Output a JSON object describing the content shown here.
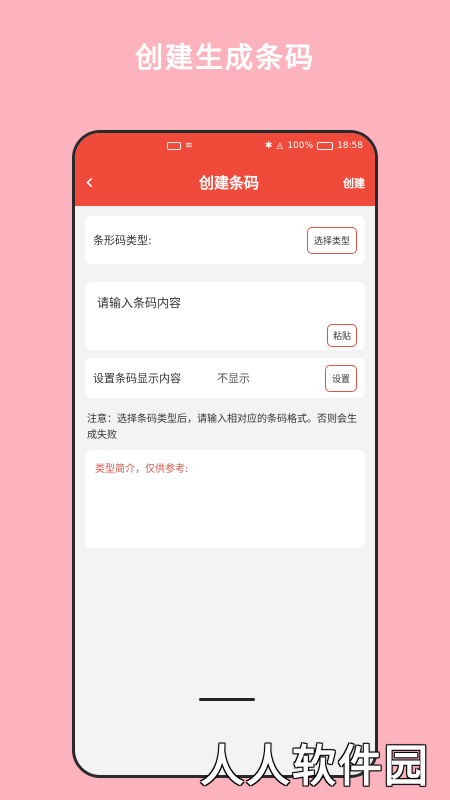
{
  "promo": {
    "title": "创建生成条码"
  },
  "status": {
    "battery": "100%",
    "time": "18:58"
  },
  "appbar": {
    "back_icon": "chevron-left-icon",
    "title": "创建条码",
    "action_label": "创建"
  },
  "type_card": {
    "label": "条形码类型:",
    "button_label": "选择类型"
  },
  "input_card": {
    "placeholder": "请输入条码内容",
    "paste_label": "粘贴"
  },
  "display_card": {
    "label": "设置条码显示内容",
    "value": "不显示",
    "button_label": "设置"
  },
  "note": "注意：选择条码类型后，请输入相对应的条码格式。否则会生成失败",
  "intro_card": {
    "text": "类型简介，仅供参考:"
  },
  "watermark": "人人软件园",
  "colors": {
    "primary": "#f04a3b",
    "background": "#fdb3bd",
    "accent_text": "#d9564a"
  }
}
